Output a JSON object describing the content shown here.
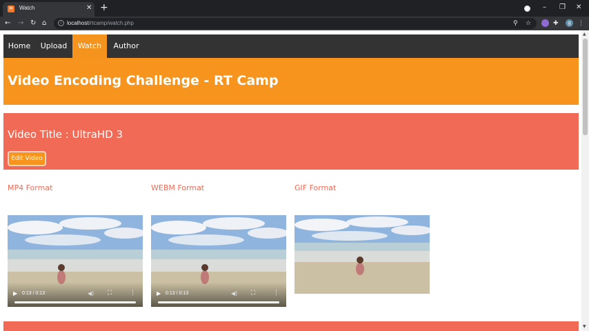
{
  "browser": {
    "tab_title": "Watch",
    "favicon_text": "M",
    "url_host": "localhost",
    "url_path": "/rtcamp/watch.php",
    "profile_initial": "g"
  },
  "nav": {
    "items": [
      {
        "label": "Home"
      },
      {
        "label": "Upload"
      },
      {
        "label": "Watch"
      },
      {
        "label": "Author"
      }
    ],
    "active_index": 2
  },
  "header": {
    "title": "Video Encoding Challenge - RT Camp"
  },
  "video": {
    "title_text": "Video Title : UltraHD 3",
    "edit_label": "Edit Video"
  },
  "formats": [
    {
      "label": "MP4 Format",
      "time": "0:13 / 0:13"
    },
    {
      "label": "WEBM Format",
      "time": "0:13 / 0:13"
    },
    {
      "label": "GIF Format"
    }
  ],
  "colors": {
    "orange": "#f7941d",
    "coral": "#f06a55",
    "navbar": "#333333"
  }
}
